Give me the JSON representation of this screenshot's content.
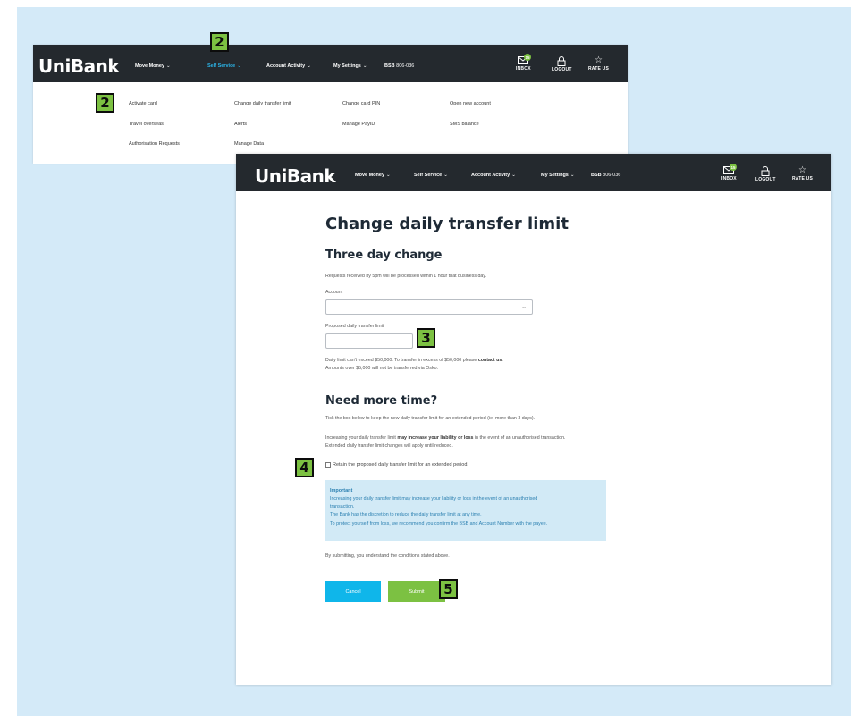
{
  "brand": {
    "logo": "UniBank",
    "accent": "#7cc142",
    "highlight": "#2bb3e6",
    "header_bg": "#24292e"
  },
  "header": {
    "nav": [
      {
        "label": "Move Money",
        "chevron": "⌄"
      },
      {
        "label": "Self Service",
        "chevron": "⌄"
      },
      {
        "label": "Account Activity",
        "chevron": "⌄"
      },
      {
        "label": "My Settings",
        "chevron": "⌄"
      }
    ],
    "bsb_label": "BSB",
    "bsb_number": "806-036",
    "inbox": {
      "label": "INBOX",
      "count": "15",
      "icon": "envelope-icon"
    },
    "logout": {
      "label": "LOGOUT",
      "icon": "lock-icon"
    },
    "rate": {
      "label": "RATE US",
      "icon": "star-icon"
    }
  },
  "dropdown_menu": {
    "columns": [
      [
        "Activate card",
        "Travel overseas",
        "Authorisation Requests"
      ],
      [
        "Change daily transfer limit",
        "Alerts",
        "Manage Data"
      ],
      [
        "Change card PIN",
        "Manage PayID"
      ],
      [
        "Open new account",
        "SMS balance"
      ]
    ]
  },
  "form": {
    "title": "Change daily transfer limit",
    "section1_title": "Three day change",
    "section1_desc": "Requests received by 5pm will be processed within 1 hour that business day.",
    "account_label": "Account",
    "account_value": "",
    "limit_label": "Proposed daily transfer limit",
    "limit_value": "",
    "limit_note_1a": "Daily limit can't exceed $50,000. To transfer in excess of $50,000 please ",
    "limit_note_1b": "contact us",
    "limit_note_1c": ".",
    "limit_note_2": "Amounts over $5,000 will not be transferred via Osko.",
    "section2_title": "Need more time?",
    "section2_desc": "Tick the box below to keep the new daily transfer limit for an extended period (ie. more than 3 days).",
    "risk_1a": "Increasing your daily transfer limit ",
    "risk_1b": "may increase your liability or loss",
    "risk_1c": " in the event of an unauthorised transaction.",
    "risk_2": "Extended daily transfer limit changes will apply until reduced.",
    "checkbox_label": "Retain the proposed daily transfer limit for an extended period.",
    "important": {
      "title": "Important",
      "lines": [
        "Increasing your daily transfer limit may increase your liability or loss in the event of an unauthorised",
        "transaction.",
        "The Bank has the discretion to reduce the daily transfer limit at any time.",
        "To protect yourself from loss, we recommend you confirm the BSB and Account Number with the payee."
      ]
    },
    "disclaimer": "By submitting, you understand the conditions stated above.",
    "cancel_label": "Cancel",
    "submit_label": "Submit"
  },
  "steps": {
    "nav": "2",
    "menu": "2",
    "limit": "3",
    "checkbox": "4",
    "submit": "5"
  }
}
